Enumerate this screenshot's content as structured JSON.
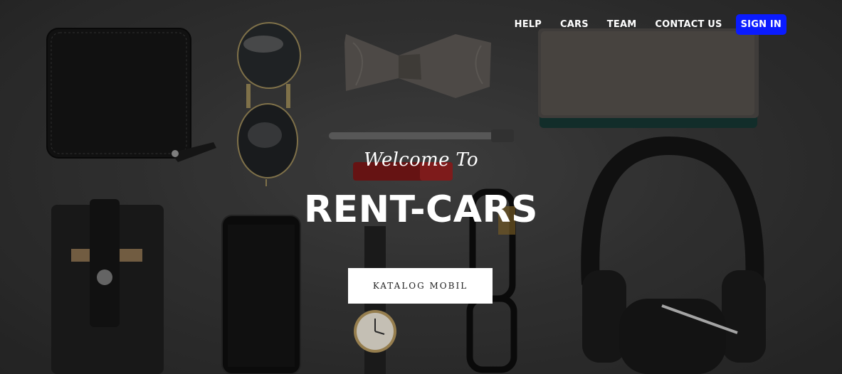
{
  "nav": {
    "items": [
      {
        "label": "HELP"
      },
      {
        "label": "CARS"
      },
      {
        "label": "TEAM"
      },
      {
        "label": "CONTACT US"
      }
    ],
    "signin_label": "SIGN IN"
  },
  "hero": {
    "welcome": "Welcome To",
    "brand": "RENT-CARS",
    "cta_label": "KATALOG MOBIL",
    "background_image": "flat-lay of accessories: wallet, sunglasses, bow tie, notebook, pen, lipstick, card holder, smartphone, wristwatch, eyeglasses, headphones"
  },
  "colors": {
    "accent": "#0a1bff",
    "text": "#ffffff",
    "button_bg": "#ffffff"
  }
}
